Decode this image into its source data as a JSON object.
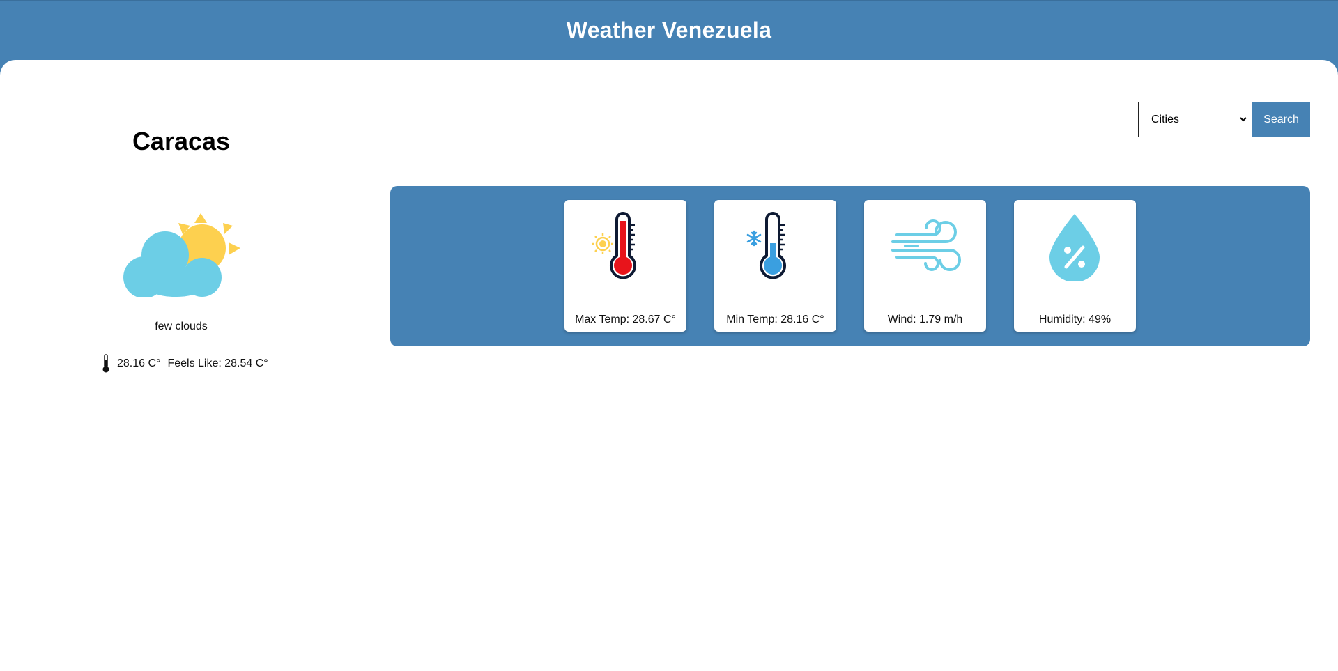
{
  "header": {
    "title": "Weather Venezuela"
  },
  "current": {
    "city": "Caracas",
    "condition_icon": "partly-cloudy-icon",
    "description": "few clouds",
    "temperature": "28.16 C°",
    "feels_like": "Feels Like: 28.54 C°"
  },
  "search": {
    "select_value": "Cities",
    "button_label": "Search"
  },
  "stats": [
    {
      "icon": "hot-thermometer-icon",
      "label": "Max Temp: 28.67 C°"
    },
    {
      "icon": "cold-thermometer-icon",
      "label": "Min Temp: 28.16 C°"
    },
    {
      "icon": "wind-icon",
      "label": "Wind: 1.79 m/h"
    },
    {
      "icon": "humidity-icon",
      "label": "Humidity: 49%"
    }
  ],
  "colors": {
    "primary": "#4682b4",
    "cloud": "#6ccee6",
    "sun": "#fdd04f",
    "hot": "#e8141b",
    "cold": "#3a9fe0",
    "dark": "#0e1a33"
  }
}
